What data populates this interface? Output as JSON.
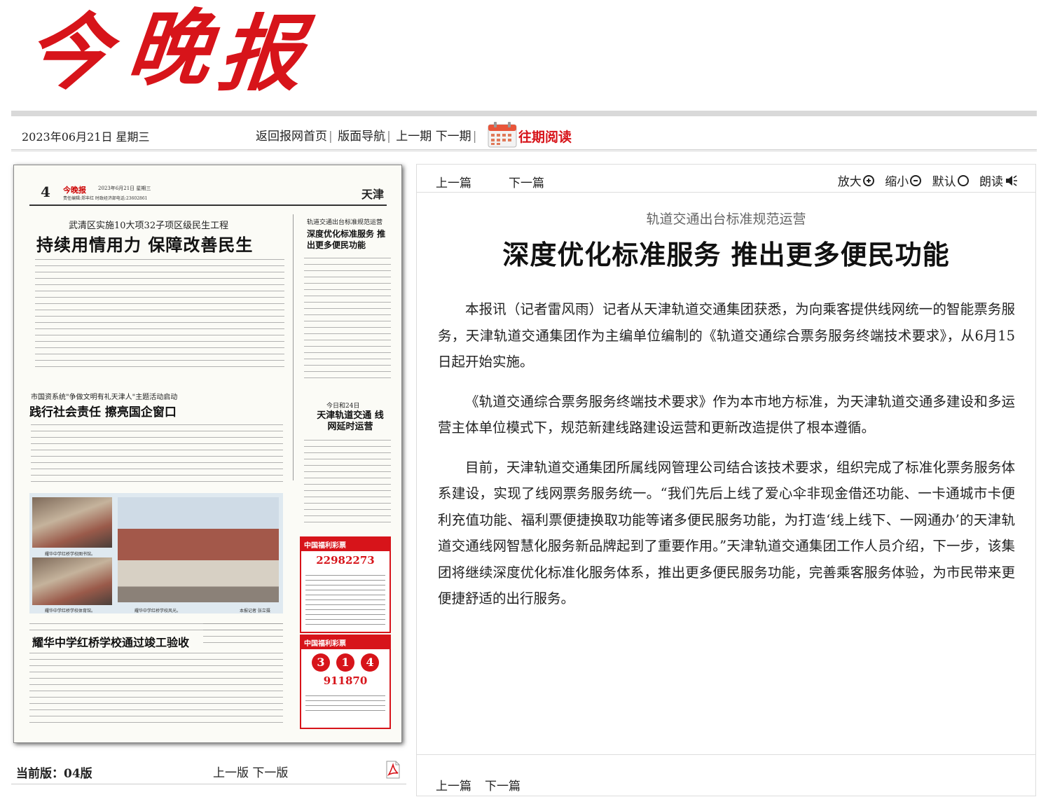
{
  "masthead": {
    "logo_chars": [
      "今",
      "晚",
      "报"
    ]
  },
  "nav": {
    "date": "2023年06月21日 星期三",
    "home": "返回报网首页",
    "layout_nav": "版面导航",
    "prev_issue": "上一期",
    "next_issue": "下一期",
    "past_read": "往期阅读"
  },
  "page_thumb": {
    "page_number": "4",
    "logo": "今晚报",
    "date": "2023年6月21日 星期三",
    "editor": "责任编辑:郑丰红 时政经济部电话:23602861",
    "region": "天津",
    "story1_kicker": "武清区实施10大项32子项区级民生工程",
    "story1_title": "持续用情用力 保障改善民生",
    "story2_kicker": "轨道交通出台标准规范运营",
    "story2_title": "深度优化标准服务 推出更多便民功能",
    "story3_kicker": "市国资系统\"争做文明有礼天津人\"主题活动启动",
    "story3_title": "践行社会责任 擦亮国企窗口",
    "story4_kicker": "今日和24日",
    "story4_title": "天津轨道交通 线网延时运营",
    "story5_title": "耀华中学红桥学校通过竣工验收",
    "photo_caption1": "耀华中学红桥学校图书馆。",
    "photo_caption2": "耀华中学红桥学校风光。",
    "photo_caption3": "耀华中学红桥学校体育馆。",
    "photo_credit": "本报记者 张立摄",
    "lottery1_head": "中国福利彩票",
    "lottery1_number": "22982273",
    "lottery2_head": "中国福利彩票",
    "lottery2_balls": [
      "3",
      "1",
      "4"
    ],
    "lottery2_number": "911870"
  },
  "bottom_left": {
    "current_label": "当前版：",
    "current_value": "04版",
    "prev_page": "上一版",
    "next_page": "下一版"
  },
  "article": {
    "prev": "上一篇",
    "next": "下一篇",
    "zoom_in": "放大",
    "zoom_out": "缩小",
    "default": "默认",
    "read_aloud": "朗读",
    "kicker": "轨道交通出台标准规范运营",
    "headline": "深度优化标准服务  推出更多便民功能",
    "paragraphs": [
      "本报讯（记者雷风雨）记者从天津轨道交通集团获悉，为向乘客提供线网统一的智能票务服务，天津轨道交通集团作为主编单位编制的《轨道交通综合票务服务终端技术要求》，从6月15日起开始实施。",
      "《轨道交通综合票务服务终端技术要求》作为本市地方标准，为天津轨道交通多建设和多运营主体单位模式下，规范新建线路建设运营和更新改造提供了根本遵循。",
      "目前，天津轨道交通集团所属线网管理公司结合该技术要求，组织完成了标准化票务服务体系建设，实现了线网票务服务统一。“我们先后上线了爱心伞非现金借还功能、一卡通城市卡便利充值功能、福利票便捷换取功能等诸多便民服务功能，为打造‘线上线下、一网通办’的天津轨道交通线网智慧化服务新品牌起到了重要作用。”天津轨道交通集团工作人员介绍，下一步，该集团将继续深度优化标准化服务体系，推出更多便民服务功能，完善乘客服务体验，为市民带来更便捷舒适的出行服务。"
    ]
  },
  "colors": {
    "brand_red": "#d7141a",
    "text": "#222222",
    "muted": "#666666"
  }
}
